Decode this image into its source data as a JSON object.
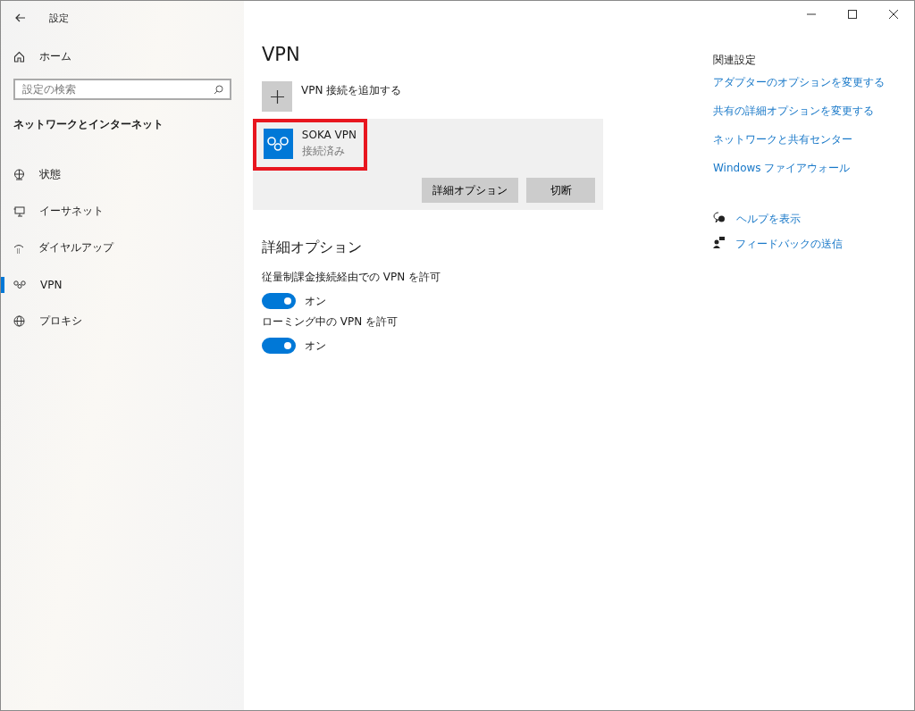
{
  "window": {
    "title": "設定"
  },
  "sidebar": {
    "home": "ホーム",
    "search": {
      "placeholder": "設定の検索"
    },
    "section": "ネットワークとインターネット",
    "items": [
      {
        "label": "状態",
        "kind": "status",
        "selected": false
      },
      {
        "label": "イーサネット",
        "kind": "ethernet",
        "selected": false
      },
      {
        "label": "ダイヤルアップ",
        "kind": "dialup",
        "selected": false
      },
      {
        "label": "VPN",
        "kind": "vpn",
        "selected": true
      },
      {
        "label": "プロキシ",
        "kind": "proxy",
        "selected": false
      }
    ]
  },
  "main": {
    "title": "VPN",
    "add_label": "VPN 接続を追加する",
    "connection": {
      "name": "SOKA VPN",
      "status": "接続済み",
      "highlighted": true,
      "buttons": [
        "詳細オプション",
        "切断"
      ]
    },
    "options_title": "詳細オプション",
    "options": [
      {
        "label": "従量制課金接続経由での VPN を許可",
        "on": true,
        "state": "オン"
      },
      {
        "label": "ローミング中の VPN を許可",
        "on": true,
        "state": "オン"
      }
    ]
  },
  "related": {
    "title": "関連設定",
    "links": [
      "アダプターのオプションを変更する",
      "共有の詳細オプションを変更する",
      "ネットワークと共有センター",
      "Windows ファイアウォール"
    ],
    "help": [
      {
        "kind": "help",
        "label": "ヘルプを表示"
      },
      {
        "kind": "feedback",
        "label": "フィードバックの送信"
      }
    ]
  }
}
